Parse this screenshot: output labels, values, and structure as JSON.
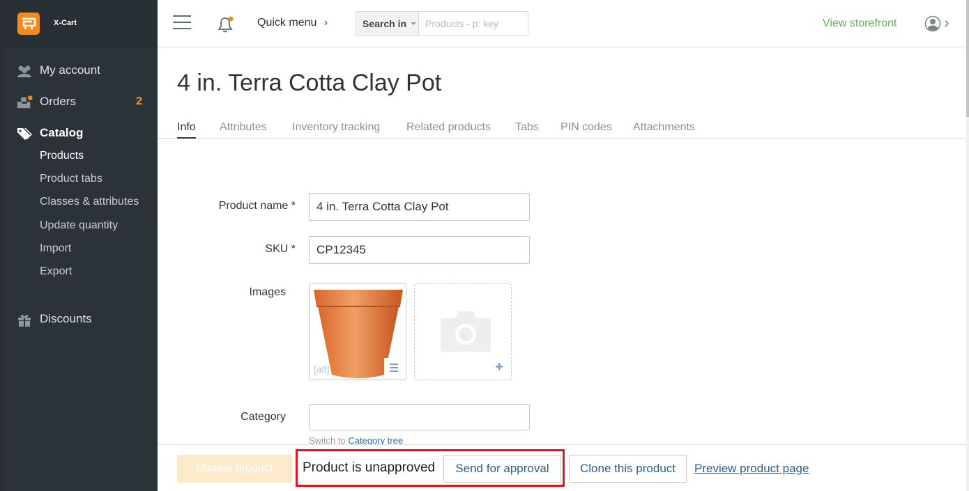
{
  "brand": "X-Cart",
  "sidebar": {
    "items": [
      {
        "label": "My account"
      },
      {
        "label": "Orders",
        "badge": "2"
      },
      {
        "label": "Catalog"
      },
      {
        "label": "Discounts"
      }
    ],
    "catalog_sub": [
      "Products",
      "Product tabs",
      "Classes & attributes",
      "Update quantity",
      "Import",
      "Export"
    ]
  },
  "topbar": {
    "quick_menu": "Quick menu",
    "search_scope": "Search in",
    "search_placeholder": "Products - p: key",
    "view_storefront": "View storefront"
  },
  "page": {
    "title": "4 in. Terra Cotta Clay Pot",
    "tabs": [
      "Info",
      "Attributes",
      "Inventory tracking",
      "Related products",
      "Tabs",
      "PIN codes",
      "Attachments"
    ],
    "active_tab": "Info"
  },
  "form": {
    "product_name_label": "Product name *",
    "product_name_value": "4 in. Terra Cotta Clay Pot",
    "sku_label": "SKU *",
    "sku_value": "CP12345",
    "images_label": "Images",
    "image_alt": "[alt]",
    "category_label": "Category",
    "category_value": "",
    "category_hint": "Switch to",
    "category_hint_link": "Category tree"
  },
  "bottom": {
    "update_button": "Update product",
    "status_text": "Product is unapproved",
    "send_approval": "Send for approval",
    "clone": "Clone this product",
    "preview": "Preview product page"
  },
  "colors": {
    "sidebar_bg": "#2b3238",
    "accent_orange": "#f48a1d",
    "storefront_green": "#5fb156",
    "highlight_red": "#e0161d",
    "link_blue": "#2a5f8e"
  }
}
